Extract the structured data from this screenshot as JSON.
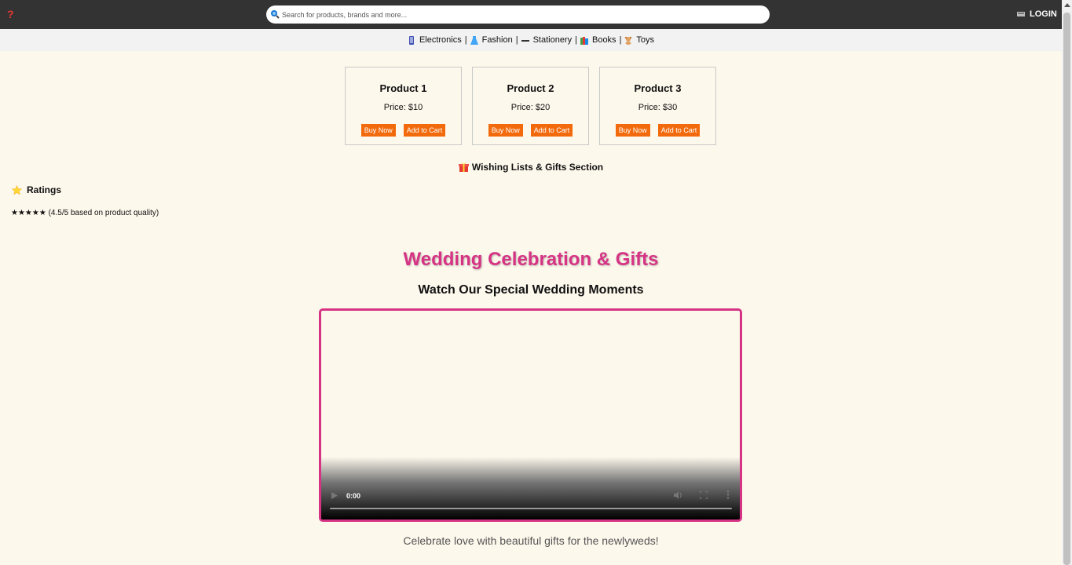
{
  "topbar": {
    "search_placeholder": "Search for products, brands and more...",
    "login_label": "LOGIN"
  },
  "categories": [
    {
      "label": "Electronics",
      "icon": "phone-icon"
    },
    {
      "label": "Fashion",
      "icon": "dress-icon"
    },
    {
      "label": "Stationery",
      "icon": "pen-icon"
    },
    {
      "label": "Books",
      "icon": "books-icon"
    },
    {
      "label": "Toys",
      "icon": "teddy-bear-icon"
    }
  ],
  "category_separator": "|",
  "products": [
    {
      "name": "Product 1",
      "price": "Price: $10",
      "buy_label": "Buy Now",
      "cart_label": "Add to Cart"
    },
    {
      "name": "Product 2",
      "price": "Price: $20",
      "buy_label": "Buy Now",
      "cart_label": "Add to Cart"
    },
    {
      "name": "Product 3",
      "price": "Price: $30",
      "buy_label": "Buy Now",
      "cart_label": "Add to Cart"
    }
  ],
  "wishlist": {
    "label": "Wishing Lists & Gifts Section",
    "icon": "gift-icon"
  },
  "ratings": {
    "title": "Ratings",
    "icon": "star-icon",
    "text": "★★★★★ (4.5/5 based on product quality)"
  },
  "wedding": {
    "title": "Wedding Celebration & Gifts",
    "subtitle": "Watch Our Special Wedding Moments",
    "video_time": "0:00",
    "caption": "Celebrate love with beautiful gifts for the newlyweds!"
  },
  "colors": {
    "topbar": "#333333",
    "accent_button": "#f26a0c",
    "wedding_pink": "#d63384",
    "background": "#fdf8ec"
  }
}
